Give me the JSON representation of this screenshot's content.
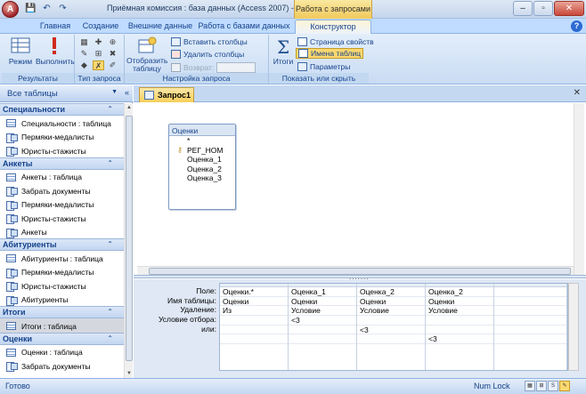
{
  "window": {
    "title": "Приёмная комиссия : база данных (Access 2007) - М...",
    "context_title": "Работа с запросами",
    "controls": {
      "minimize": "–",
      "maximize": "▫",
      "close": "✕"
    }
  },
  "qat": {
    "save": "💾",
    "undo": "↶",
    "redo": "↷"
  },
  "ribbon_tabs": [
    "Главная",
    "Создание",
    "Внешние данные",
    "Работа с базами данных",
    "Конструктор"
  ],
  "ribbon": {
    "results": {
      "label": "Результаты",
      "view": "Режим",
      "run": "Выполнить"
    },
    "query_type": {
      "label": "Тип запроса"
    },
    "setup": {
      "label": "Настройка запроса",
      "show_table": "Отобразить таблицу",
      "insert_columns": "Вставить столбцы",
      "delete_columns": "Удалить столбцы",
      "return": "Возврат:"
    },
    "show_hide": {
      "label": "Показать или скрыть",
      "totals": "Итоги",
      "property_sheet": "Страница свойств",
      "table_names": "Имена таблиц",
      "parameters": "Параметры"
    }
  },
  "nav": {
    "header": "Все таблицы",
    "groups": [
      {
        "name": "Специальности",
        "items": [
          {
            "label": "Специальности : таблица",
            "icon": "table-icon",
            "selected": false
          },
          {
            "label": "Пермяки-медалисты",
            "icon": "query-icon",
            "selected": false
          },
          {
            "label": "Юристы-стажисты",
            "icon": "query-icon",
            "selected": false
          }
        ]
      },
      {
        "name": "Анкеты",
        "items": [
          {
            "label": "Анкеты : таблица",
            "icon": "table-icon",
            "selected": false
          },
          {
            "label": "Забрать документы",
            "icon": "query-icon",
            "selected": false
          },
          {
            "label": "Пермяки-медалисты",
            "icon": "query-icon",
            "selected": false
          },
          {
            "label": "Юристы-стажисты",
            "icon": "query-icon",
            "selected": false
          },
          {
            "label": "Анкеты",
            "icon": "query-icon",
            "selected": false
          }
        ]
      },
      {
        "name": "Абитуриенты",
        "items": [
          {
            "label": "Абитуриенты : таблица",
            "icon": "table-icon",
            "selected": false
          },
          {
            "label": "Пермяки-медалисты",
            "icon": "query-icon",
            "selected": false
          },
          {
            "label": "Юристы-стажисты",
            "icon": "query-icon",
            "selected": false
          },
          {
            "label": "Абитуриенты",
            "icon": "query-icon",
            "selected": false
          }
        ]
      },
      {
        "name": "Итоги",
        "items": [
          {
            "label": "Итоги : таблица",
            "icon": "table-icon",
            "selected": true
          }
        ]
      },
      {
        "name": "Оценки",
        "items": [
          {
            "label": "Оценки : таблица",
            "icon": "table-icon",
            "selected": false
          },
          {
            "label": "Забрать документы",
            "icon": "query-icon",
            "selected": false
          }
        ]
      }
    ]
  },
  "document": {
    "tab": "Запрос1",
    "close": "✕",
    "table": {
      "name": "Оценки",
      "fields": [
        {
          "name": "*",
          "key": false
        },
        {
          "name": "РЕГ_НОМ",
          "key": true
        },
        {
          "name": "Оценка_1",
          "key": false
        },
        {
          "name": "Оценка_2",
          "key": false
        },
        {
          "name": "Оценка_3",
          "key": false
        }
      ]
    },
    "grid": {
      "row_labels": [
        "Поле:",
        "Имя таблицы:",
        "Удаление:",
        "Условие отбора:",
        "или:"
      ],
      "columns": [
        [
          "Оценки.*",
          "Оценки",
          "Из",
          "",
          "",
          ""
        ],
        [
          "Оценка_1",
          "Оценки",
          "Условие",
          "<3",
          "",
          ""
        ],
        [
          "Оценка_2",
          "Оценки",
          "Условие",
          "",
          "<3",
          ""
        ],
        [
          "Оценка_2",
          "Оценки",
          "Условие",
          "",
          "",
          "<3"
        ],
        [
          "",
          "",
          "",
          "",
          "",
          ""
        ]
      ]
    }
  },
  "statusbar": {
    "left": "Готово",
    "right": "Num Lock"
  },
  "colors": {
    "accent": "#15428b",
    "ribbon_bg": "#c9dcf4",
    "context_tab": "#f1c95c",
    "selected_nav": "#d4d8de"
  }
}
